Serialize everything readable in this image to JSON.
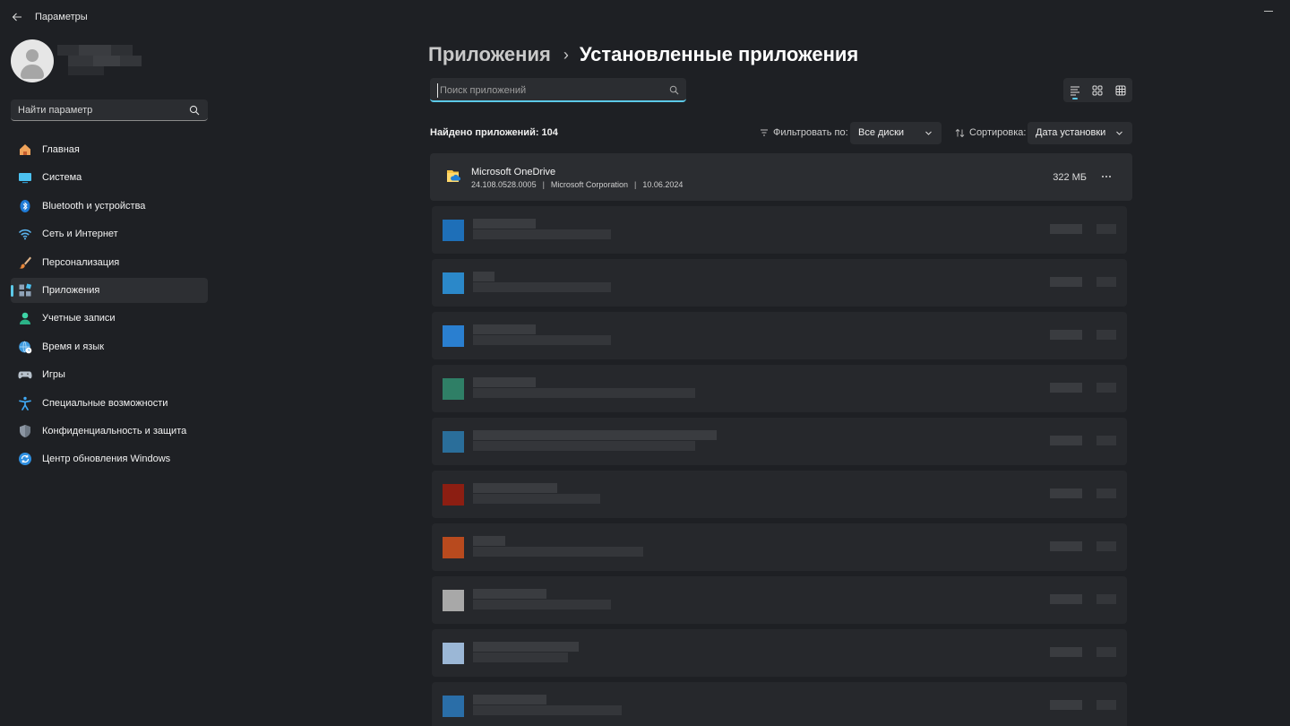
{
  "window": {
    "title": "Параметры",
    "back_icon": "arrow-left-icon",
    "minimize_icon": "minimize-icon"
  },
  "profile": {
    "user_name_redacted": true
  },
  "sidebar": {
    "search_placeholder": "Найти параметр",
    "items": [
      {
        "label": "Главная",
        "icon": "home-icon",
        "active": false
      },
      {
        "label": "Система",
        "icon": "system-display-icon",
        "active": false
      },
      {
        "label": "Bluetooth и устройства",
        "icon": "bluetooth-icon",
        "active": false
      },
      {
        "label": "Сеть и Интернет",
        "icon": "wifi-icon",
        "active": false
      },
      {
        "label": "Персонализация",
        "icon": "brush-icon",
        "active": false
      },
      {
        "label": "Приложения",
        "icon": "apps-icon",
        "active": true
      },
      {
        "label": "Учетные записи",
        "icon": "account-icon",
        "active": false
      },
      {
        "label": "Время и язык",
        "icon": "globe-clock-icon",
        "active": false
      },
      {
        "label": "Игры",
        "icon": "gamepad-icon",
        "active": false
      },
      {
        "label": "Специальные возможности",
        "icon": "accessibility-icon",
        "active": false
      },
      {
        "label": "Конфиденциальность и защита",
        "icon": "shield-icon",
        "active": false
      },
      {
        "label": "Центр обновления Windows",
        "icon": "update-icon",
        "active": false
      }
    ]
  },
  "header": {
    "breadcrumb_parent": "Приложения",
    "breadcrumb_separator": "›",
    "breadcrumb_current": "Установленные приложения"
  },
  "main": {
    "search_placeholder": "Поиск приложений",
    "found_text": "Найдено приложений: 104",
    "filter_label": "Фильтровать по:",
    "filter_value": "Все диски",
    "sort_label": "Сортировка:",
    "sort_value": "Дата установки",
    "view_modes": [
      "list-view-icon",
      "tiles-view-icon",
      "grid-view-icon"
    ],
    "selected_view": "list-view-icon"
  },
  "apps": [
    {
      "name": "Microsoft OneDrive",
      "version": "24.108.0528.0005",
      "publisher": "Microsoft Corporation",
      "date": "10.06.2024",
      "size": "322 МБ",
      "icon": "onedrive-folder-icon"
    }
  ],
  "redacted_rows": [
    {
      "icon_color": "#1e6fb8"
    },
    {
      "icon_color": "#2b88c9"
    },
    {
      "icon_color": "#2a7fd0"
    },
    {
      "icon_color": "#2f7f66"
    },
    {
      "icon_color": "#2a6e9a"
    },
    {
      "icon_color": "#8c1e12"
    },
    {
      "icon_color": "#b84a1e"
    },
    {
      "icon_color": "#a8a8a8"
    },
    {
      "icon_color": "#9bb7d6"
    },
    {
      "icon_color": "#2a6ea8"
    }
  ],
  "colors": {
    "background": "#1e2024",
    "accent": "#5cc9e8",
    "card": "#2b2d31"
  }
}
